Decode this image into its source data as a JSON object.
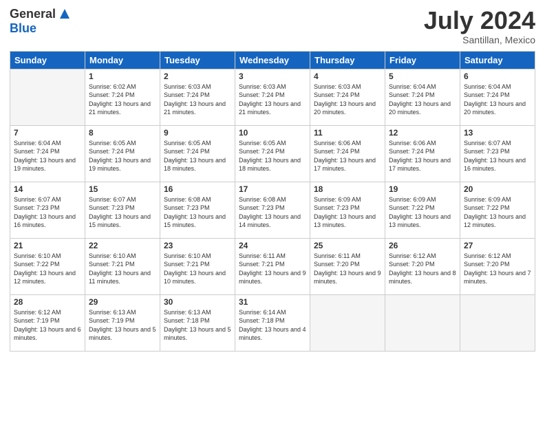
{
  "header": {
    "logo_general": "General",
    "logo_blue": "Blue",
    "month": "July 2024",
    "location": "Santillan, Mexico"
  },
  "days_of_week": [
    "Sunday",
    "Monday",
    "Tuesday",
    "Wednesday",
    "Thursday",
    "Friday",
    "Saturday"
  ],
  "weeks": [
    [
      {
        "day": "",
        "sunrise": "",
        "sunset": "",
        "daylight": "",
        "empty": true
      },
      {
        "day": "1",
        "sunrise": "Sunrise: 6:02 AM",
        "sunset": "Sunset: 7:24 PM",
        "daylight": "Daylight: 13 hours and 21 minutes.",
        "empty": false
      },
      {
        "day": "2",
        "sunrise": "Sunrise: 6:03 AM",
        "sunset": "Sunset: 7:24 PM",
        "daylight": "Daylight: 13 hours and 21 minutes.",
        "empty": false
      },
      {
        "day": "3",
        "sunrise": "Sunrise: 6:03 AM",
        "sunset": "Sunset: 7:24 PM",
        "daylight": "Daylight: 13 hours and 21 minutes.",
        "empty": false
      },
      {
        "day": "4",
        "sunrise": "Sunrise: 6:03 AM",
        "sunset": "Sunset: 7:24 PM",
        "daylight": "Daylight: 13 hours and 20 minutes.",
        "empty": false
      },
      {
        "day": "5",
        "sunrise": "Sunrise: 6:04 AM",
        "sunset": "Sunset: 7:24 PM",
        "daylight": "Daylight: 13 hours and 20 minutes.",
        "empty": false
      },
      {
        "day": "6",
        "sunrise": "Sunrise: 6:04 AM",
        "sunset": "Sunset: 7:24 PM",
        "daylight": "Daylight: 13 hours and 20 minutes.",
        "empty": false
      }
    ],
    [
      {
        "day": "7",
        "sunrise": "Sunrise: 6:04 AM",
        "sunset": "Sunset: 7:24 PM",
        "daylight": "Daylight: 13 hours and 19 minutes.",
        "empty": false
      },
      {
        "day": "8",
        "sunrise": "Sunrise: 6:05 AM",
        "sunset": "Sunset: 7:24 PM",
        "daylight": "Daylight: 13 hours and 19 minutes.",
        "empty": false
      },
      {
        "day": "9",
        "sunrise": "Sunrise: 6:05 AM",
        "sunset": "Sunset: 7:24 PM",
        "daylight": "Daylight: 13 hours and 18 minutes.",
        "empty": false
      },
      {
        "day": "10",
        "sunrise": "Sunrise: 6:05 AM",
        "sunset": "Sunset: 7:24 PM",
        "daylight": "Daylight: 13 hours and 18 minutes.",
        "empty": false
      },
      {
        "day": "11",
        "sunrise": "Sunrise: 6:06 AM",
        "sunset": "Sunset: 7:24 PM",
        "daylight": "Daylight: 13 hours and 17 minutes.",
        "empty": false
      },
      {
        "day": "12",
        "sunrise": "Sunrise: 6:06 AM",
        "sunset": "Sunset: 7:24 PM",
        "daylight": "Daylight: 13 hours and 17 minutes.",
        "empty": false
      },
      {
        "day": "13",
        "sunrise": "Sunrise: 6:07 AM",
        "sunset": "Sunset: 7:23 PM",
        "daylight": "Daylight: 13 hours and 16 minutes.",
        "empty": false
      }
    ],
    [
      {
        "day": "14",
        "sunrise": "Sunrise: 6:07 AM",
        "sunset": "Sunset: 7:23 PM",
        "daylight": "Daylight: 13 hours and 16 minutes.",
        "empty": false
      },
      {
        "day": "15",
        "sunrise": "Sunrise: 6:07 AM",
        "sunset": "Sunset: 7:23 PM",
        "daylight": "Daylight: 13 hours and 15 minutes.",
        "empty": false
      },
      {
        "day": "16",
        "sunrise": "Sunrise: 6:08 AM",
        "sunset": "Sunset: 7:23 PM",
        "daylight": "Daylight: 13 hours and 15 minutes.",
        "empty": false
      },
      {
        "day": "17",
        "sunrise": "Sunrise: 6:08 AM",
        "sunset": "Sunset: 7:23 PM",
        "daylight": "Daylight: 13 hours and 14 minutes.",
        "empty": false
      },
      {
        "day": "18",
        "sunrise": "Sunrise: 6:09 AM",
        "sunset": "Sunset: 7:23 PM",
        "daylight": "Daylight: 13 hours and 13 minutes.",
        "empty": false
      },
      {
        "day": "19",
        "sunrise": "Sunrise: 6:09 AM",
        "sunset": "Sunset: 7:22 PM",
        "daylight": "Daylight: 13 hours and 13 minutes.",
        "empty": false
      },
      {
        "day": "20",
        "sunrise": "Sunrise: 6:09 AM",
        "sunset": "Sunset: 7:22 PM",
        "daylight": "Daylight: 13 hours and 12 minutes.",
        "empty": false
      }
    ],
    [
      {
        "day": "21",
        "sunrise": "Sunrise: 6:10 AM",
        "sunset": "Sunset: 7:22 PM",
        "daylight": "Daylight: 13 hours and 12 minutes.",
        "empty": false
      },
      {
        "day": "22",
        "sunrise": "Sunrise: 6:10 AM",
        "sunset": "Sunset: 7:21 PM",
        "daylight": "Daylight: 13 hours and 11 minutes.",
        "empty": false
      },
      {
        "day": "23",
        "sunrise": "Sunrise: 6:10 AM",
        "sunset": "Sunset: 7:21 PM",
        "daylight": "Daylight: 13 hours and 10 minutes.",
        "empty": false
      },
      {
        "day": "24",
        "sunrise": "Sunrise: 6:11 AM",
        "sunset": "Sunset: 7:21 PM",
        "daylight": "Daylight: 13 hours and 9 minutes.",
        "empty": false
      },
      {
        "day": "25",
        "sunrise": "Sunrise: 6:11 AM",
        "sunset": "Sunset: 7:20 PM",
        "daylight": "Daylight: 13 hours and 9 minutes.",
        "empty": false
      },
      {
        "day": "26",
        "sunrise": "Sunrise: 6:12 AM",
        "sunset": "Sunset: 7:20 PM",
        "daylight": "Daylight: 13 hours and 8 minutes.",
        "empty": false
      },
      {
        "day": "27",
        "sunrise": "Sunrise: 6:12 AM",
        "sunset": "Sunset: 7:20 PM",
        "daylight": "Daylight: 13 hours and 7 minutes.",
        "empty": false
      }
    ],
    [
      {
        "day": "28",
        "sunrise": "Sunrise: 6:12 AM",
        "sunset": "Sunset: 7:19 PM",
        "daylight": "Daylight: 13 hours and 6 minutes.",
        "empty": false
      },
      {
        "day": "29",
        "sunrise": "Sunrise: 6:13 AM",
        "sunset": "Sunset: 7:19 PM",
        "daylight": "Daylight: 13 hours and 5 minutes.",
        "empty": false
      },
      {
        "day": "30",
        "sunrise": "Sunrise: 6:13 AM",
        "sunset": "Sunset: 7:18 PM",
        "daylight": "Daylight: 13 hours and 5 minutes.",
        "empty": false
      },
      {
        "day": "31",
        "sunrise": "Sunrise: 6:14 AM",
        "sunset": "Sunset: 7:18 PM",
        "daylight": "Daylight: 13 hours and 4 minutes.",
        "empty": false
      },
      {
        "day": "",
        "sunrise": "",
        "sunset": "",
        "daylight": "",
        "empty": true
      },
      {
        "day": "",
        "sunrise": "",
        "sunset": "",
        "daylight": "",
        "empty": true
      },
      {
        "day": "",
        "sunrise": "",
        "sunset": "",
        "daylight": "",
        "empty": true
      }
    ]
  ]
}
